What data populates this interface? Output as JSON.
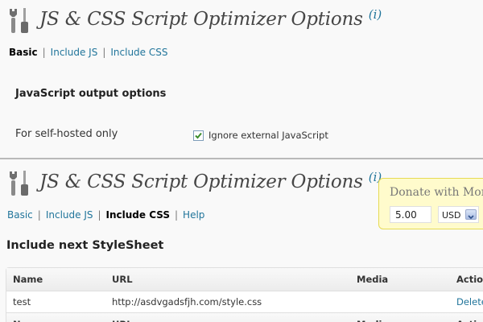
{
  "top": {
    "title": "JS & CSS Script Optimizer Options",
    "info": "(i)",
    "subnav": [
      "Basic",
      "Include JS",
      "Include CSS"
    ],
    "section": "JavaScript output options",
    "row_label": "For self-hosted only",
    "checkbox": {
      "label": "Ignore external JavaScript",
      "checked": true
    }
  },
  "bottom": {
    "title": "JS & CSS Script Optimizer Options",
    "info": "(i)",
    "subnav": [
      "Basic",
      "Include JS",
      "Include CSS",
      "Help"
    ],
    "donate": {
      "title": "Donate with Moneybookers",
      "amount": "5.00",
      "currency": "USD"
    },
    "section": "Include next StyleSheet",
    "table": {
      "headers": [
        "Name",
        "URL",
        "Media",
        "Actions"
      ],
      "rows": [
        {
          "name": "test",
          "url": "http://asdvgadsfjh.com/style.css",
          "media": "",
          "action": "Delete"
        }
      ]
    }
  },
  "colors": {
    "link": "#21759b",
    "donate_bg": "#fffbcc",
    "donate_border": "#e6db55",
    "checkbox_check": "#3c8c2a"
  }
}
